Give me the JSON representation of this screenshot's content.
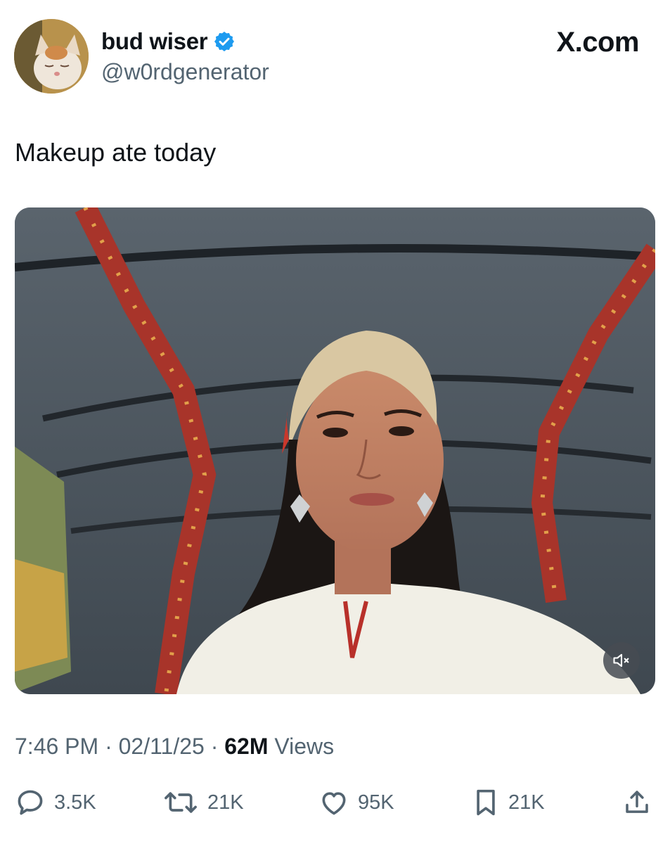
{
  "author": {
    "display_name": "bud wiser",
    "handle": "@w0rdgenerator",
    "verified": true,
    "verified_color": "#1d9bf0",
    "avatar_icon": "cat-avatar"
  },
  "brand": "X.com",
  "tweet": {
    "text": "Makeup ate today",
    "media_icon": "video-thumbnail",
    "mute_icon": "speaker-muted-icon"
  },
  "meta": {
    "time": "7:46 PM",
    "separator": " · ",
    "date": "02/11/25",
    "views_count": "62M",
    "views_label": " Views"
  },
  "actions": {
    "replies": "3.5K",
    "reposts": "21K",
    "likes": "95K",
    "bookmarks": "21K"
  }
}
